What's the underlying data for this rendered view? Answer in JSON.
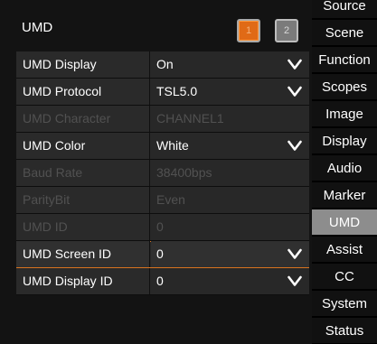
{
  "panel": {
    "title": "UMD",
    "pages": [
      "1",
      "2"
    ],
    "rows": [
      {
        "label": "UMD Display",
        "value": "On",
        "disabled": false,
        "dropdown": true,
        "selected": false
      },
      {
        "label": "UMD Protocol",
        "value": "TSL5.0",
        "disabled": false,
        "dropdown": true,
        "selected": false
      },
      {
        "label": "UMD Character",
        "value": "CHANNEL1",
        "disabled": true,
        "dropdown": false,
        "selected": false
      },
      {
        "label": "UMD Color",
        "value": "White",
        "disabled": false,
        "dropdown": true,
        "selected": false
      },
      {
        "label": "Baud Rate",
        "value": "38400bps",
        "disabled": true,
        "dropdown": false,
        "selected": false
      },
      {
        "label": "ParityBit",
        "value": "Even",
        "disabled": true,
        "dropdown": false,
        "selected": false
      },
      {
        "label": "UMD ID",
        "value": "0",
        "disabled": true,
        "dropdown": false,
        "selected": false
      },
      {
        "label": "UMD Screen ID",
        "value": "0",
        "disabled": false,
        "dropdown": true,
        "selected": true
      },
      {
        "label": "UMD Display ID",
        "value": "0",
        "disabled": false,
        "dropdown": true,
        "selected": false
      }
    ]
  },
  "sidebar": {
    "items": [
      {
        "label": "Source",
        "active": false
      },
      {
        "label": "Scene",
        "active": false
      },
      {
        "label": "Function",
        "active": false
      },
      {
        "label": "Scopes",
        "active": false
      },
      {
        "label": "Image",
        "active": false
      },
      {
        "label": "Display",
        "active": false
      },
      {
        "label": "Audio",
        "active": false
      },
      {
        "label": "Marker",
        "active": false
      },
      {
        "label": "UMD",
        "active": true
      },
      {
        "label": "Assist",
        "active": false
      },
      {
        "label": "CC",
        "active": false
      },
      {
        "label": "System",
        "active": false
      },
      {
        "label": "Status",
        "active": false
      }
    ]
  },
  "colors": {
    "accent": "#e06a16",
    "selected_outline": "#d9731f",
    "active_nav": "#8d8d8d",
    "disabled_text": "#515151"
  },
  "icons": {
    "dropdown": "chevron-down-icon"
  }
}
